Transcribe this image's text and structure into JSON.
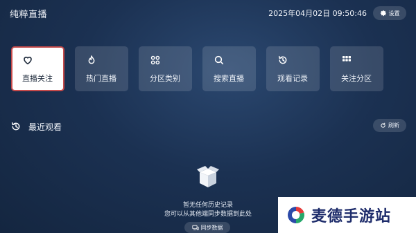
{
  "header": {
    "app_title": "纯粹直播",
    "datetime": "2025年04月02日 09:50:46",
    "settings_label": "设置"
  },
  "tiles": [
    {
      "label": "直播关注",
      "icon": "heart-icon",
      "selected": true
    },
    {
      "label": "热门直播",
      "icon": "flame-icon",
      "selected": false
    },
    {
      "label": "分区类别",
      "icon": "category-icon",
      "selected": false
    },
    {
      "label": "搜索直播",
      "icon": "search-icon",
      "selected": false
    },
    {
      "label": "观看记录",
      "icon": "history-icon",
      "selected": false
    },
    {
      "label": "关注分区",
      "icon": "grid-icon",
      "selected": false
    }
  ],
  "recent": {
    "title": "最近观看",
    "refresh_label": "刷新",
    "empty_line1": "暂无任何历史记录",
    "empty_line2": "您可以从其他端同步数据到此处",
    "sync_label": "同步数据"
  },
  "watermark": {
    "text": "麦德手游站"
  },
  "colors": {
    "background": "#1b3152",
    "selected_border": "#c64a4a",
    "watermark_text": "#1e2c6b"
  }
}
